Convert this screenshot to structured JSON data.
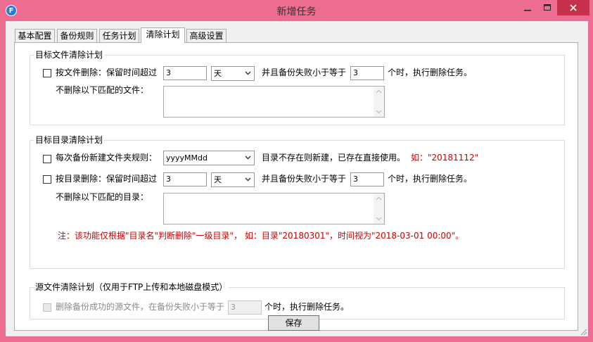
{
  "window": {
    "title": "新增任务",
    "icon_letter": "F"
  },
  "tabs": [
    "基本配置",
    "备份规则",
    "任务计划",
    "清除计划",
    "高级设置"
  ],
  "active_tab": "清除计划",
  "target_file": {
    "title": "目标文件清除计划",
    "by_file_label": "按文件删除：保留时间超过",
    "keep_value": "3",
    "unit_value": "天",
    "and_fail_label": "并且备份失败小于等于",
    "fail_value": "3",
    "suffix": "个时，执行删除任务。",
    "exclude_label": "不删除以下匹配的文件："
  },
  "target_dir": {
    "title": "目标目录清除计划",
    "new_folder_label": "每次备份新建文件夹规则：",
    "folder_rule_value": "yyyyMMdd",
    "dir_info": "目录不存在则新建，已存在直接使用。",
    "example": "如：\"20181112\"",
    "by_dir_label": "按目录删除：保留时间超过",
    "keep_value": "3",
    "unit_value": "天",
    "and_fail_label": "并且备份失败小于等于",
    "fail_value": "3",
    "suffix": "个时，执行删除任务。",
    "exclude_label": "不删除以下匹配的目录：",
    "note": "注：该功能仅根据\"目录名\"判断删除\"一级目录\"，  如：目录\"20180301\"，时间视为\"2018-03-01 00:00\"。"
  },
  "source_file": {
    "title": "源文件清除计划（仅用于FTP上传和本地磁盘模式）",
    "delete_label": "删除备份成功的源文件，在备份失败小于等于",
    "fail_value": "3",
    "suffix": "个时，执行删除任务。"
  },
  "save_label": "保存",
  "colors": {
    "frame": "#ec6d8f",
    "close_button": "#c7314b",
    "note_red": "#cc0000"
  }
}
